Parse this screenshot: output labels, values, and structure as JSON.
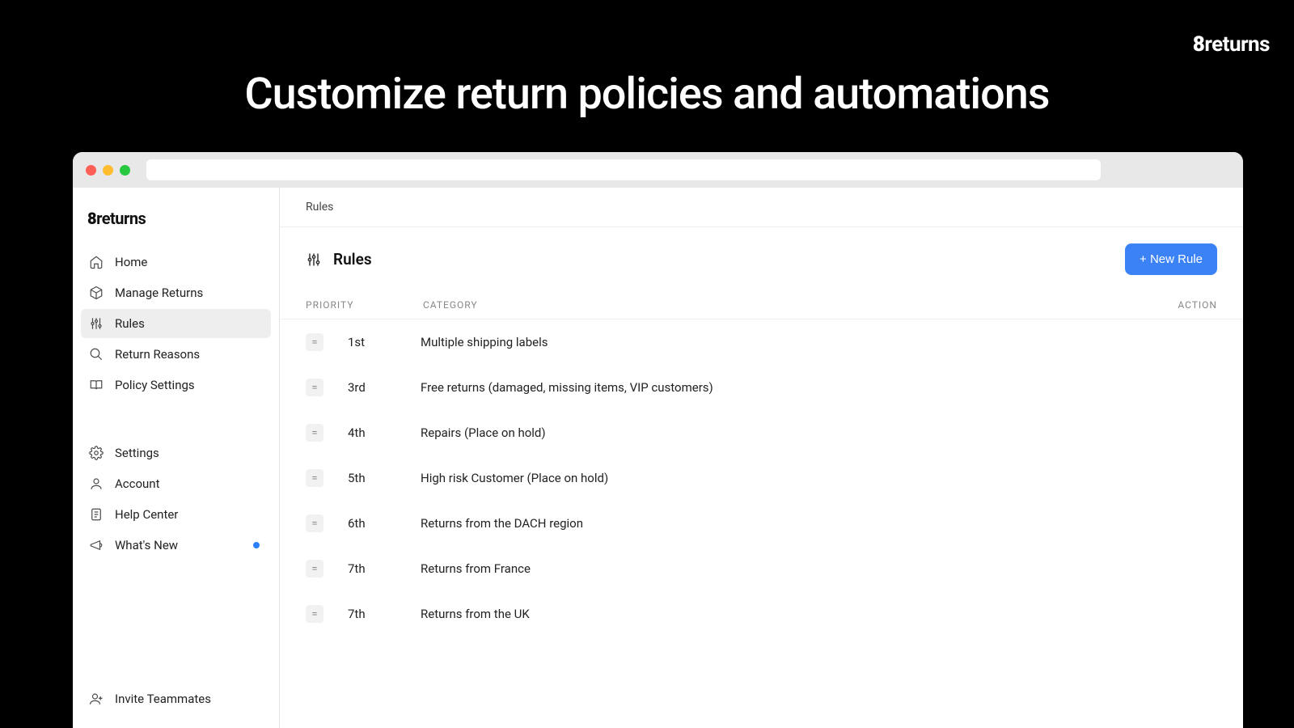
{
  "brand": "returns",
  "headline": "Customize return policies and automations",
  "sidebar_logo": "returns",
  "nav_primary": [
    {
      "label": "Home"
    },
    {
      "label": "Manage Returns"
    },
    {
      "label": "Rules"
    },
    {
      "label": "Return Reasons"
    },
    {
      "label": "Policy Settings"
    }
  ],
  "nav_secondary": [
    {
      "label": "Settings"
    },
    {
      "label": "Account"
    },
    {
      "label": "Help Center"
    },
    {
      "label": "What's New"
    }
  ],
  "nav_footer": {
    "label": "Invite Teammates"
  },
  "breadcrumb": "Rules",
  "page_title": "Rules",
  "new_rule_btn": "+ New Rule",
  "table_headers": {
    "priority": "PRIORITY",
    "category": "CATEGORY",
    "action": "ACTION"
  },
  "rules": [
    {
      "priority": "1st",
      "category": "Multiple shipping labels"
    },
    {
      "priority": "3rd",
      "category": "Free returns (damaged, missing items, VIP customers)"
    },
    {
      "priority": "4th",
      "category": "Repairs (Place on hold)"
    },
    {
      "priority": "5th",
      "category": "High risk Customer (Place on hold)"
    },
    {
      "priority": "6th",
      "category": "Returns from the DACH region"
    },
    {
      "priority": "7th",
      "category": "Returns from France"
    },
    {
      "priority": "7th",
      "category": "Returns from the UK"
    }
  ]
}
